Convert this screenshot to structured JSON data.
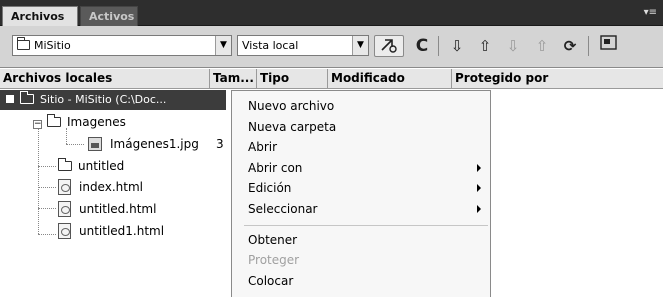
{
  "tabs": [
    {
      "label": "Archivos"
    },
    {
      "label": "Activos"
    }
  ],
  "toolbar": {
    "site_value": "MiSitio",
    "view_value": "Vista local",
    "buttons": [
      "connect-icon",
      "refresh-icon",
      "get-icon",
      "put-icon",
      "checkout-icon",
      "checkin-icon",
      "sync-icon",
      "expand-icon"
    ]
  },
  "columns": [
    {
      "label": "Archivos locales"
    },
    {
      "label": "Tam..."
    },
    {
      "label": "Tipo"
    },
    {
      "label": "Modificado"
    },
    {
      "label": "Protegido por"
    }
  ],
  "tree": {
    "site": "Sitio - MiSitio (C:\\Doc...",
    "items": [
      {
        "name": "Imagenes",
        "size": ""
      },
      {
        "name": "Imágenes1.jpg",
        "size": "3"
      },
      {
        "name": "untitled",
        "size": ""
      },
      {
        "name": "index.html",
        "size": ""
      },
      {
        "name": "untitled.html",
        "size": ""
      },
      {
        "name": "untitled1.html",
        "size": ""
      }
    ]
  },
  "context_menu": {
    "items": [
      {
        "label": "Nuevo archivo"
      },
      {
        "label": "Nueva carpeta"
      },
      {
        "label": "Abrir"
      },
      {
        "label": "Abrir con"
      },
      {
        "label": "Edición"
      },
      {
        "label": "Seleccionar"
      },
      {
        "label": "Obtener"
      },
      {
        "label": "Proteger"
      },
      {
        "label": "Colocar"
      }
    ]
  }
}
